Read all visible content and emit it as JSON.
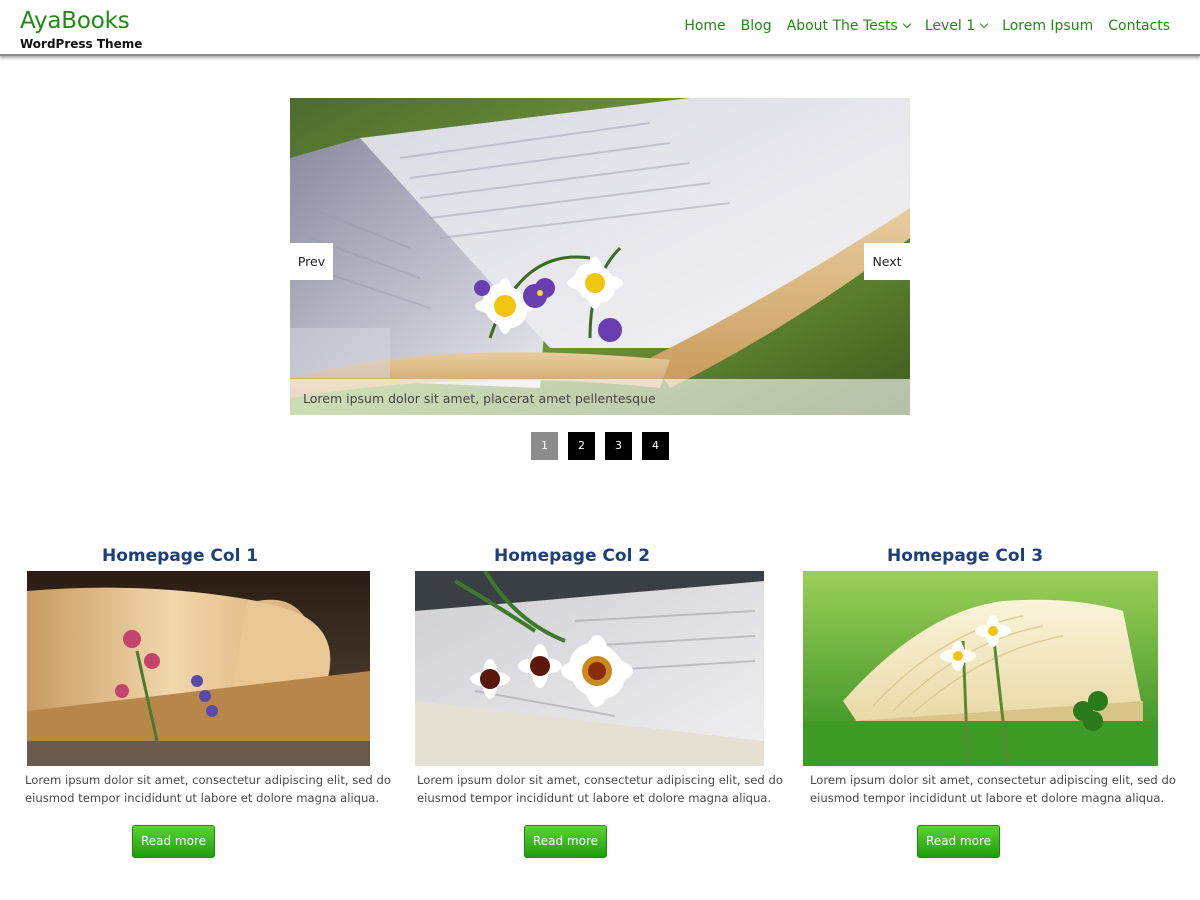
{
  "header": {
    "site_title": "AyaBooks",
    "tagline": "WordPress Theme",
    "nav": [
      {
        "label": "Home"
      },
      {
        "label": "Blog"
      },
      {
        "label": "About The Tests"
      },
      {
        "label": "Level 1"
      },
      {
        "label": "Lorem Ipsum"
      },
      {
        "label": "Contacts"
      }
    ]
  },
  "slider": {
    "caption": "Lorem ipsum dolor sit amet, placerat amet pellentesque",
    "prev_label": "Prev",
    "next_label": "Next",
    "pages": [
      "1",
      "2",
      "3",
      "4"
    ],
    "active_page": "1"
  },
  "columns": [
    {
      "title": "Homepage Col 1",
      "text_line1": "Lorem ipsum dolor sit amet, consectetur adipiscing elit, sed do",
      "text_line2": "eiusmod tempor incididunt ut labore et dolore magna aliqua.",
      "button": "Read more"
    },
    {
      "title": "Homepage Col 2",
      "text_line1": "Lorem ipsum dolor sit amet, consectetur adipiscing elit, sed do",
      "text_line2": "eiusmod tempor incididunt ut labore et dolore magna aliqua.",
      "button": "Read more"
    },
    {
      "title": "Homepage Col 3",
      "text_line1": "Lorem ipsum dolor sit amet, consectetur adipiscing elit, sed do",
      "text_line2": "eiusmod tempor incididunt ut labore et dolore magna aliqua.",
      "button": "Read more"
    }
  ],
  "colors": {
    "brand_green": "#1f8a12",
    "heading_blue": "#1d3f7a",
    "button_green": "#2aa516"
  }
}
